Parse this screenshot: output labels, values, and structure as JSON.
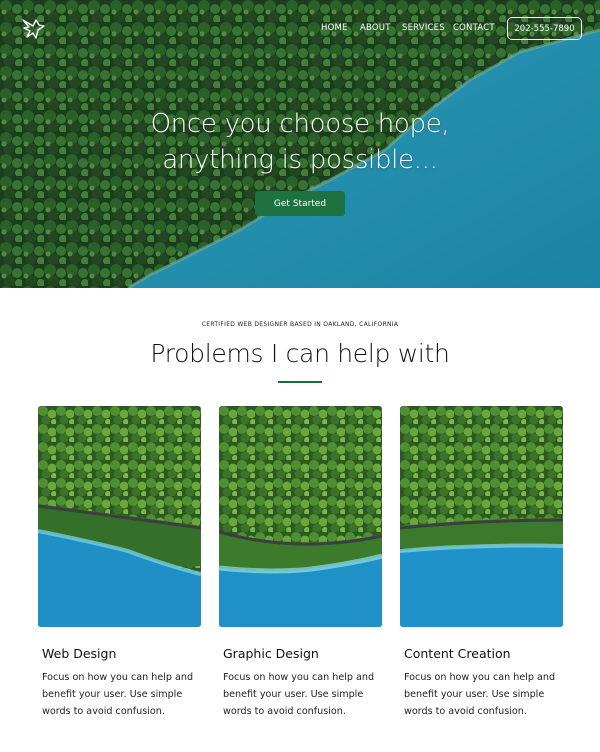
{
  "nav": {
    "logo": "dove-logo-icon",
    "links": [
      "HOME",
      "ABOUT",
      "SERVICES",
      "CONTACT"
    ],
    "phone": "202-555-7890"
  },
  "hero": {
    "title_line1": "Once you choose hope,",
    "title_line2": "anything is possible...",
    "cta": "Get Started"
  },
  "section": {
    "eyebrow": "CERTIFIED WEB DESIGNER BASED IN OAKLAND, CALIFORNIA",
    "title": "Problems I can help with"
  },
  "cards": [
    {
      "title": "Web Design",
      "body": "Focus on how you can help and benefit your user. Use simple words to avoid confusion."
    },
    {
      "title": "Graphic Design",
      "body": "Focus on how you can help and benefit your user. Use simple words to avoid confusion."
    },
    {
      "title": "Content Creation",
      "body": "Focus on how you can help and benefit your user. Use simple words to avoid confusion."
    }
  ],
  "colors": {
    "accent": "#1d7240",
    "forest": "#1f4a22",
    "water": "#2a9fc0"
  }
}
